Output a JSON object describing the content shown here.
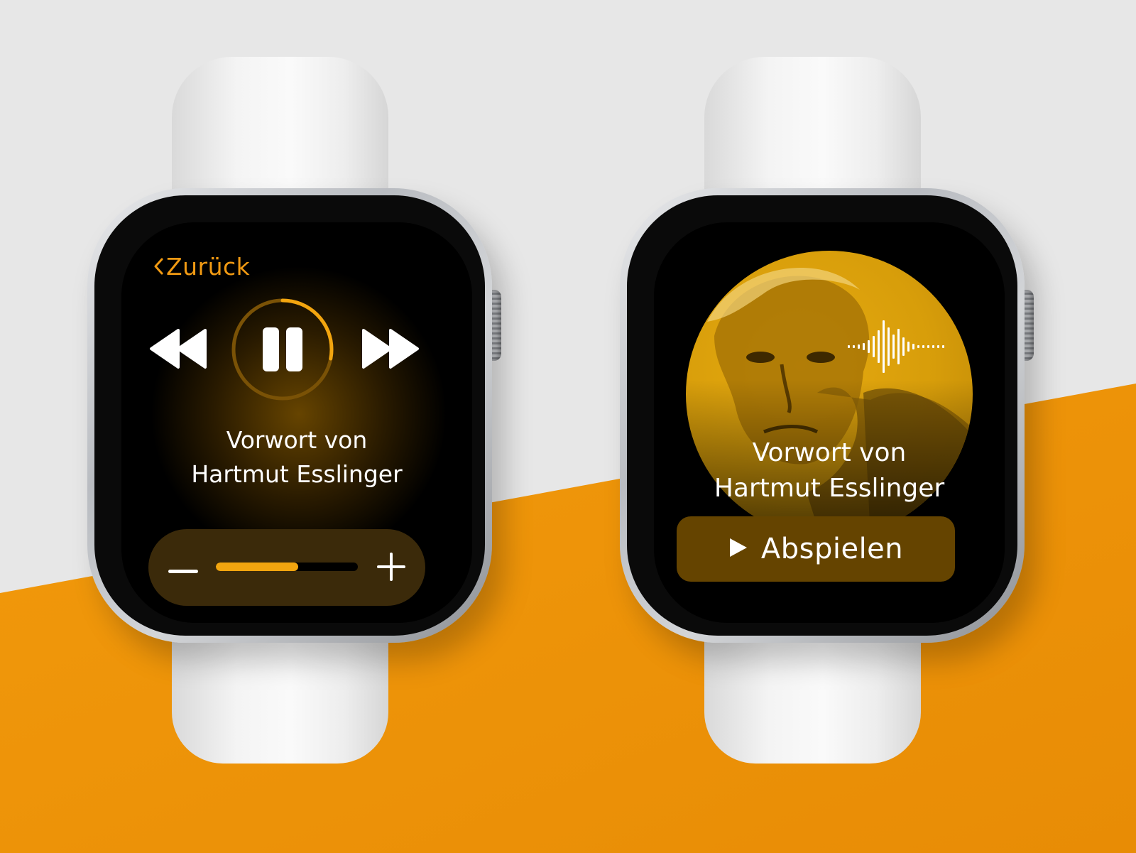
{
  "colors": {
    "accent": "#f19a13",
    "background_light": "#e6e6e6",
    "background_orange": "#f0950a",
    "screen": "#000000",
    "button_bg": "#654400"
  },
  "watch_left": {
    "back_label": "Zurück",
    "icons": {
      "back": "chevron-left-icon",
      "rewind": "rewind-icon",
      "pause": "pause-icon",
      "forward": "fast-forward-icon",
      "volume_down": "minus-icon",
      "volume_up": "plus-icon"
    },
    "progress": 0.28,
    "volume": 0.58,
    "title_line1": "Vorwort von",
    "title_line2": "Hartmut Esslinger"
  },
  "watch_right": {
    "title_line1": "Vorwort von",
    "title_line2": "Hartmut Esslinger",
    "play_label": "Abspielen",
    "icons": {
      "audio": "waveform-icon",
      "play": "play-icon",
      "portrait": "portrait-image"
    }
  }
}
